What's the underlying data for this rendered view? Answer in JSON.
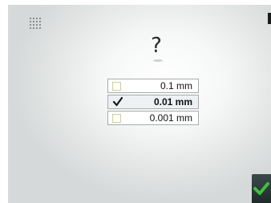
{
  "prompt": {
    "symbol": "?"
  },
  "options": [
    {
      "label": "0.1 mm",
      "checked": false
    },
    {
      "label": "0.01 mm",
      "checked": true
    },
    {
      "label": "0.001 mm",
      "checked": false
    }
  ],
  "icons": {
    "grid": "grid-icon",
    "check": "check-icon",
    "confirm": "confirm-checkmark-icon"
  },
  "colors": {
    "checkbox_border": "#c9d38a",
    "confirm_check": "#3fbf3f",
    "confirm_bg": "#2a3636"
  }
}
